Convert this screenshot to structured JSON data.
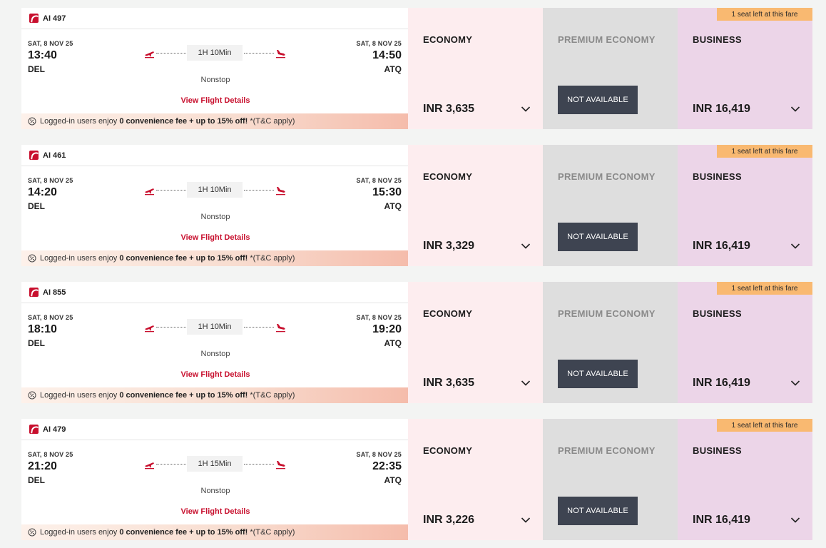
{
  "common": {
    "economy_label": "ECONOMY",
    "premium_label": "PREMIUM ECONOMY",
    "business_label": "BUSINESS",
    "not_available": "NOT AVAILABLE",
    "seat_badge": "1 seat left at this fare",
    "view_details": "View Flight Details",
    "promo_prefix": "Logged-in users enjoy",
    "promo_bold": "0 convenience fee + up to 15% off!",
    "promo_suffix": "*(T&C apply)",
    "brand_color": "#c8102e",
    "icons": [
      "airline-logo-icon",
      "takeoff-icon",
      "landing-icon",
      "discount-icon",
      "chevron-down-icon"
    ]
  },
  "flights": [
    {
      "flight_no": "AI 497",
      "dep_date": "SAT, 8 NOV 25",
      "dep_time": "13:40",
      "dep_code": "DEL",
      "arr_date": "SAT, 8 NOV 25",
      "arr_time": "14:50",
      "arr_code": "ATQ",
      "duration": "1H 10Min",
      "stops": "Nonstop",
      "economy_price": "INR 3,635",
      "business_price": "INR 16,419"
    },
    {
      "flight_no": "AI 461",
      "dep_date": "SAT, 8 NOV 25",
      "dep_time": "14:20",
      "dep_code": "DEL",
      "arr_date": "SAT, 8 NOV 25",
      "arr_time": "15:30",
      "arr_code": "ATQ",
      "duration": "1H 10Min",
      "stops": "Nonstop",
      "economy_price": "INR 3,329",
      "business_price": "INR 16,419"
    },
    {
      "flight_no": "AI 855",
      "dep_date": "SAT, 8 NOV 25",
      "dep_time": "18:10",
      "dep_code": "DEL",
      "arr_date": "SAT, 8 NOV 25",
      "arr_time": "19:20",
      "arr_code": "ATQ",
      "duration": "1H 10Min",
      "stops": "Nonstop",
      "economy_price": "INR 3,635",
      "business_price": "INR 16,419"
    },
    {
      "flight_no": "AI 479",
      "dep_date": "SAT, 8 NOV 25",
      "dep_time": "21:20",
      "dep_code": "DEL",
      "arr_date": "SAT, 8 NOV 25",
      "arr_time": "22:35",
      "arr_code": "ATQ",
      "duration": "1H 15Min",
      "stops": "Nonstop",
      "economy_price": "INR 3,226",
      "business_price": "INR 16,419"
    }
  ]
}
